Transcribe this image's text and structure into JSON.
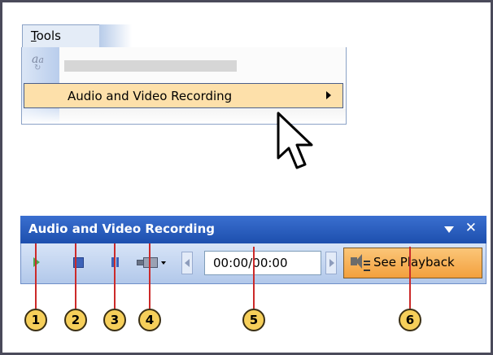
{
  "menu": {
    "tools_prefix": "T",
    "tools_underlined": "",
    "tools_rest": "ools",
    "tools_label": "Tools",
    "icon": "translate-icon",
    "item_label": "Audio and Video Recording"
  },
  "toolbar": {
    "title": "Audio and Video Recording",
    "time": "00:00/00:00",
    "see_playback": "See Playback",
    "buttons": [
      "play-icon",
      "stop-icon",
      "pause-icon",
      "camera-icon"
    ]
  },
  "callouts": [
    "1",
    "2",
    "3",
    "4",
    "5",
    "6"
  ],
  "colors": {
    "title_bar": "#2a5fc0",
    "menu_highlight": "#fde0aa",
    "see_playback": "#f6b25a",
    "callout_fill": "#f6cf5a",
    "callout_line": "#cc2a2a"
  }
}
